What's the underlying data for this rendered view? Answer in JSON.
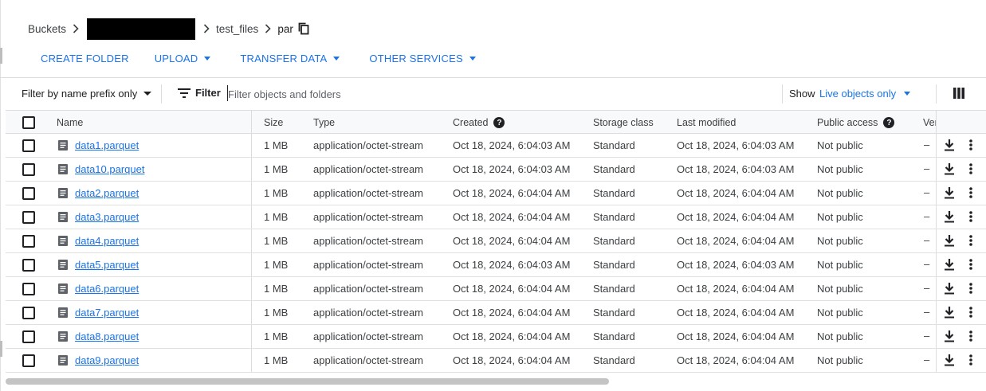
{
  "breadcrumb": {
    "root": "Buckets",
    "folder": "test_files",
    "current": "par"
  },
  "actions": [
    {
      "label": "CREATE FOLDER",
      "caret": false
    },
    {
      "label": "UPLOAD",
      "caret": true
    },
    {
      "label": "TRANSFER DATA",
      "caret": true
    },
    {
      "label": "OTHER SERVICES",
      "caret": true
    }
  ],
  "filterbar": {
    "prefix_mode": "Filter by name prefix only",
    "filter_label": "Filter",
    "placeholder": "Filter objects and folders",
    "show_label": "Show",
    "show_value": "Live objects only"
  },
  "table": {
    "columns": {
      "name": "Name",
      "size": "Size",
      "type": "Type",
      "created": "Created",
      "storage_class": "Storage class",
      "last_modified": "Last modified",
      "public_access": "Public access",
      "version": "Ver"
    },
    "rows": [
      {
        "name": "data1.parquet",
        "size": "1 MB",
        "type": "application/octet-stream",
        "created": "Oct 18, 2024, 6:04:03 AM",
        "storage_class": "Standard",
        "last_modified": "Oct 18, 2024, 6:04:03 AM",
        "public_access": "Not public",
        "version": "–"
      },
      {
        "name": "data10.parquet",
        "size": "1 MB",
        "type": "application/octet-stream",
        "created": "Oct 18, 2024, 6:04:03 AM",
        "storage_class": "Standard",
        "last_modified": "Oct 18, 2024, 6:04:03 AM",
        "public_access": "Not public",
        "version": "–"
      },
      {
        "name": "data2.parquet",
        "size": "1 MB",
        "type": "application/octet-stream",
        "created": "Oct 18, 2024, 6:04:04 AM",
        "storage_class": "Standard",
        "last_modified": "Oct 18, 2024, 6:04:04 AM",
        "public_access": "Not public",
        "version": "–"
      },
      {
        "name": "data3.parquet",
        "size": "1 MB",
        "type": "application/octet-stream",
        "created": "Oct 18, 2024, 6:04:04 AM",
        "storage_class": "Standard",
        "last_modified": "Oct 18, 2024, 6:04:04 AM",
        "public_access": "Not public",
        "version": "–"
      },
      {
        "name": "data4.parquet",
        "size": "1 MB",
        "type": "application/octet-stream",
        "created": "Oct 18, 2024, 6:04:04 AM",
        "storage_class": "Standard",
        "last_modified": "Oct 18, 2024, 6:04:04 AM",
        "public_access": "Not public",
        "version": "–"
      },
      {
        "name": "data5.parquet",
        "size": "1 MB",
        "type": "application/octet-stream",
        "created": "Oct 18, 2024, 6:04:03 AM",
        "storage_class": "Standard",
        "last_modified": "Oct 18, 2024, 6:04:03 AM",
        "public_access": "Not public",
        "version": "–"
      },
      {
        "name": "data6.parquet",
        "size": "1 MB",
        "type": "application/octet-stream",
        "created": "Oct 18, 2024, 6:04:04 AM",
        "storage_class": "Standard",
        "last_modified": "Oct 18, 2024, 6:04:04 AM",
        "public_access": "Not public",
        "version": "–"
      },
      {
        "name": "data7.parquet",
        "size": "1 MB",
        "type": "application/octet-stream",
        "created": "Oct 18, 2024, 6:04:04 AM",
        "storage_class": "Standard",
        "last_modified": "Oct 18, 2024, 6:04:04 AM",
        "public_access": "Not public",
        "version": "–"
      },
      {
        "name": "data8.parquet",
        "size": "1 MB",
        "type": "application/octet-stream",
        "created": "Oct 18, 2024, 6:04:04 AM",
        "storage_class": "Standard",
        "last_modified": "Oct 18, 2024, 6:04:04 AM",
        "public_access": "Not public",
        "version": "–"
      },
      {
        "name": "data9.parquet",
        "size": "1 MB",
        "type": "application/octet-stream",
        "created": "Oct 18, 2024, 6:04:04 AM",
        "storage_class": "Standard",
        "last_modified": "Oct 18, 2024, 6:04:04 AM",
        "public_access": "Not public",
        "version": "–"
      }
    ]
  },
  "colors": {
    "link": "#1a73e8",
    "header_bg": "#f8f9fa",
    "border": "#dadce0"
  }
}
